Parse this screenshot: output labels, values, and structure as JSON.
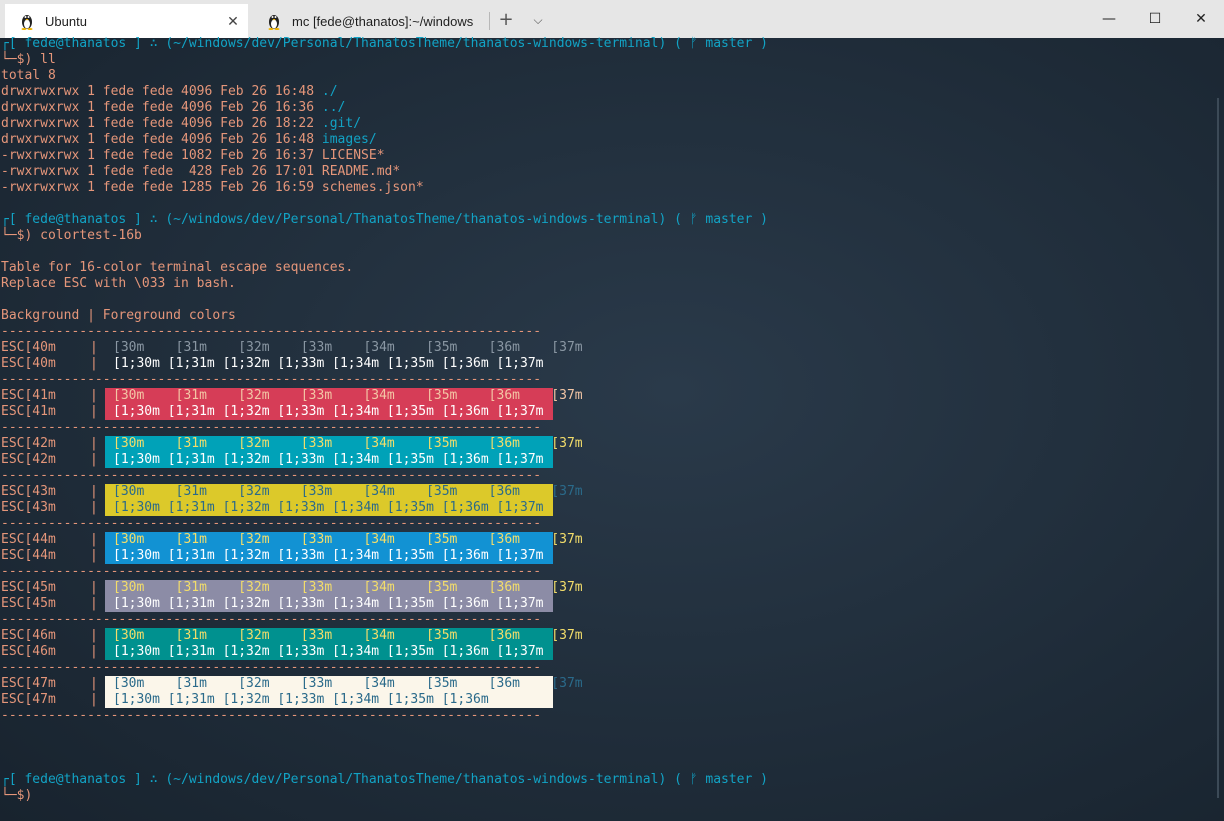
{
  "window": {
    "tabs": [
      {
        "label": "Ubuntu",
        "active": true,
        "icon": "linux-tux-icon"
      },
      {
        "label": "mc [fede@thanatos]:~/windows",
        "active": false,
        "icon": "linux-tux-icon"
      }
    ],
    "controls": {
      "new_tab": "+",
      "dropdown": "⌵",
      "minimize": "—",
      "maximize": "☐",
      "close": "✕"
    }
  },
  "colors": {
    "bg41": "#d63d57",
    "bg42": "#00a2b8",
    "bg43": "#dcc92a",
    "bg44": "#1292d3",
    "bg45": "#8c8ca6",
    "bg46": "#00918f",
    "bg47": "#fbf6ea"
  },
  "terminal": {
    "prompt1": "┌[ fede@thanatos ] ∴ (~/windows/dev/Personal/ThanatosTheme/thanatos-windows-terminal) ( ᚠ master )",
    "cmd1": "└─$) ll",
    "total": "total 8",
    "ls": [
      {
        "perm": "drwxrwxrwx 1 fede fede 4096 Feb 26 16:48 ",
        "name": "./"
      },
      {
        "perm": "drwxrwxrwx 1 fede fede 4096 Feb 26 16:36 ",
        "name": "../"
      },
      {
        "perm": "drwxrwxrwx 1 fede fede 4096 Feb 26 18:22 ",
        "name": ".git/"
      },
      {
        "perm": "drwxrwxrwx 1 fede fede 4096 Feb 26 16:48 ",
        "name": "images/"
      },
      {
        "perm": "-rwxrwxrwx 1 fede fede 1082 Feb 26 16:37 ",
        "name": "LICENSE*"
      },
      {
        "perm": "-rwxrwxrwx 1 fede fede  428 Feb 26 17:01 ",
        "name": "README.md*"
      },
      {
        "perm": "-rwxrwxrwx 1 fede fede 1285 Feb 26 16:59 ",
        "name": "schemes.json*"
      }
    ],
    "prompt2": "┌[ fede@thanatos ] ∴ (~/windows/dev/Personal/ThanatosTheme/thanatos-windows-terminal) ( ᚠ master )",
    "cmd2": "└─$) colortest-16b",
    "info1": "Table for 16-color terminal escape sequences.",
    "info2": "Replace ESC with \\033 in bash.",
    "header": "Background | Foreground colors",
    "divider": "---------------------------------------------------------------------",
    "rows": [
      {
        "bg": "ESC[40m",
        "fg1": "[30m    [31m    [32m    [33m    [34m    [35m    [36m    [37m",
        "fg2": "[1;30m [1;31m [1;32m [1;33m [1;34m [1;35m [1;36m [1;37m"
      },
      {
        "bg": "ESC[41m",
        "fg1": "[30m    [31m    [32m    [33m    [34m    [35m    [36m    [37m",
        "fg2": "[1;30m [1;31m [1;32m [1;33m [1;34m [1;35m [1;36m [1;37m"
      },
      {
        "bg": "ESC[42m",
        "fg1": "[30m    [31m    [32m    [33m    [34m    [35m    [36m    [37m",
        "fg2": "[1;30m [1;31m [1;32m [1;33m [1;34m [1;35m [1;36m [1;37m"
      },
      {
        "bg": "ESC[43m",
        "fg1": "[30m    [31m    [32m    [33m    [34m    [35m    [36m    [37m",
        "fg2": "[1;30m [1;31m [1;32m [1;33m [1;34m [1;35m [1;36m [1;37m"
      },
      {
        "bg": "ESC[44m",
        "fg1": "[30m    [31m    [32m    [33m    [34m    [35m    [36m    [37m",
        "fg2": "[1;30m [1;31m [1;32m [1;33m [1;34m [1;35m [1;36m [1;37m"
      },
      {
        "bg": "ESC[45m",
        "fg1": "[30m    [31m    [32m    [33m    [34m    [35m    [36m    [37m",
        "fg2": "[1;30m [1;31m [1;32m [1;33m [1;34m [1;35m [1;36m [1;37m"
      },
      {
        "bg": "ESC[46m",
        "fg1": "[30m    [31m    [32m    [33m    [34m    [35m    [36m    [37m",
        "fg2": "[1;30m [1;31m [1;32m [1;33m [1;34m [1;35m [1;36m [1;37m"
      },
      {
        "bg": "ESC[47m",
        "fg1": "[30m    [31m    [32m    [33m    [34m    [35m    [36m    [37m",
        "fg2": "[1;30m [1;31m [1;32m [1;33m [1;34m [1;35m [1;36m"
      }
    ],
    "prompt3": "┌[ fede@thanatos ] ∴ (~/windows/dev/Personal/ThanatosTheme/thanatos-windows-terminal) ( ᚠ master )",
    "cmd3": "└─$)"
  }
}
